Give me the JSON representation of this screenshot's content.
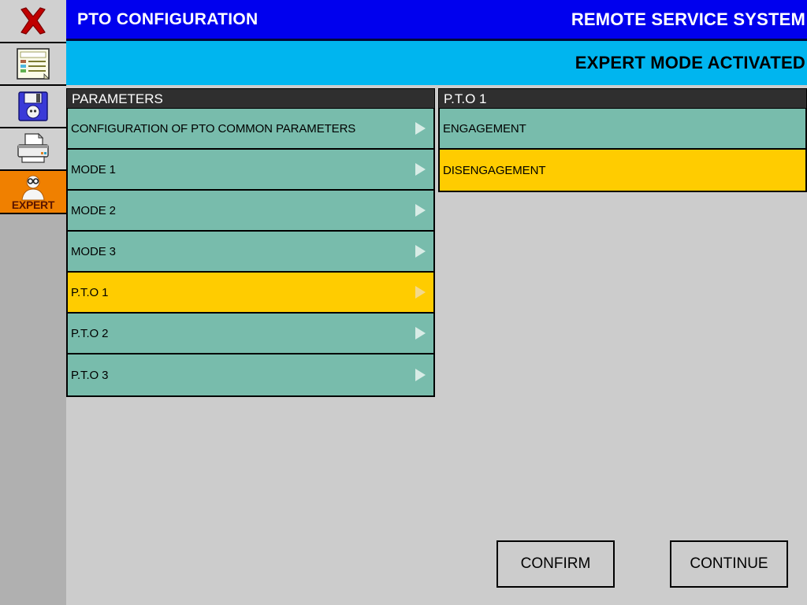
{
  "header": {
    "screen_title": "PTO CONFIGURATION",
    "system_name": "REMOTE SERVICE SYSTEM",
    "mode_message": "EXPERT MODE ACTIVATED",
    "title_bar_color": "#0000EE",
    "mode_bar_color": "#00B5EF"
  },
  "toolbar": {
    "items": [
      {
        "name": "close-icon",
        "label": ""
      },
      {
        "name": "document-icon",
        "label": ""
      },
      {
        "name": "save-icon",
        "label": ""
      },
      {
        "name": "print-icon",
        "label": ""
      },
      {
        "name": "expert-icon",
        "label": "EXPERT"
      }
    ],
    "expert_label": "EXPERT",
    "expert_active_color": "#F08000"
  },
  "left_panel": {
    "header": "PARAMETERS",
    "items": [
      {
        "label": "CONFIGURATION OF PTO COMMON PARAMETERS",
        "selected": false,
        "has_arrow": true
      },
      {
        "label": "MODE 1",
        "selected": false,
        "has_arrow": true
      },
      {
        "label": "MODE 2",
        "selected": false,
        "has_arrow": true
      },
      {
        "label": "MODE 3",
        "selected": false,
        "has_arrow": true
      },
      {
        "label": "P.T.O 1",
        "selected": true,
        "has_arrow": true
      },
      {
        "label": "P.T.O 2",
        "selected": false,
        "has_arrow": true
      },
      {
        "label": "P.T.O 3",
        "selected": false,
        "has_arrow": true
      }
    ]
  },
  "right_panel": {
    "header": "P.T.O 1",
    "items": [
      {
        "label": "ENGAGEMENT",
        "selected": false,
        "has_arrow": false
      },
      {
        "label": "DISENGAGEMENT",
        "selected": true,
        "has_arrow": false
      }
    ]
  },
  "footer": {
    "confirm_label": "CONFIRM",
    "continue_label": "CONTINUE"
  },
  "colors": {
    "item_normal": "#78BCAC",
    "item_selected": "#FFCC00",
    "panel_header": "#2F2F2F",
    "background": "#CCCCCC",
    "toolbar_background": "#B0B0B0"
  }
}
